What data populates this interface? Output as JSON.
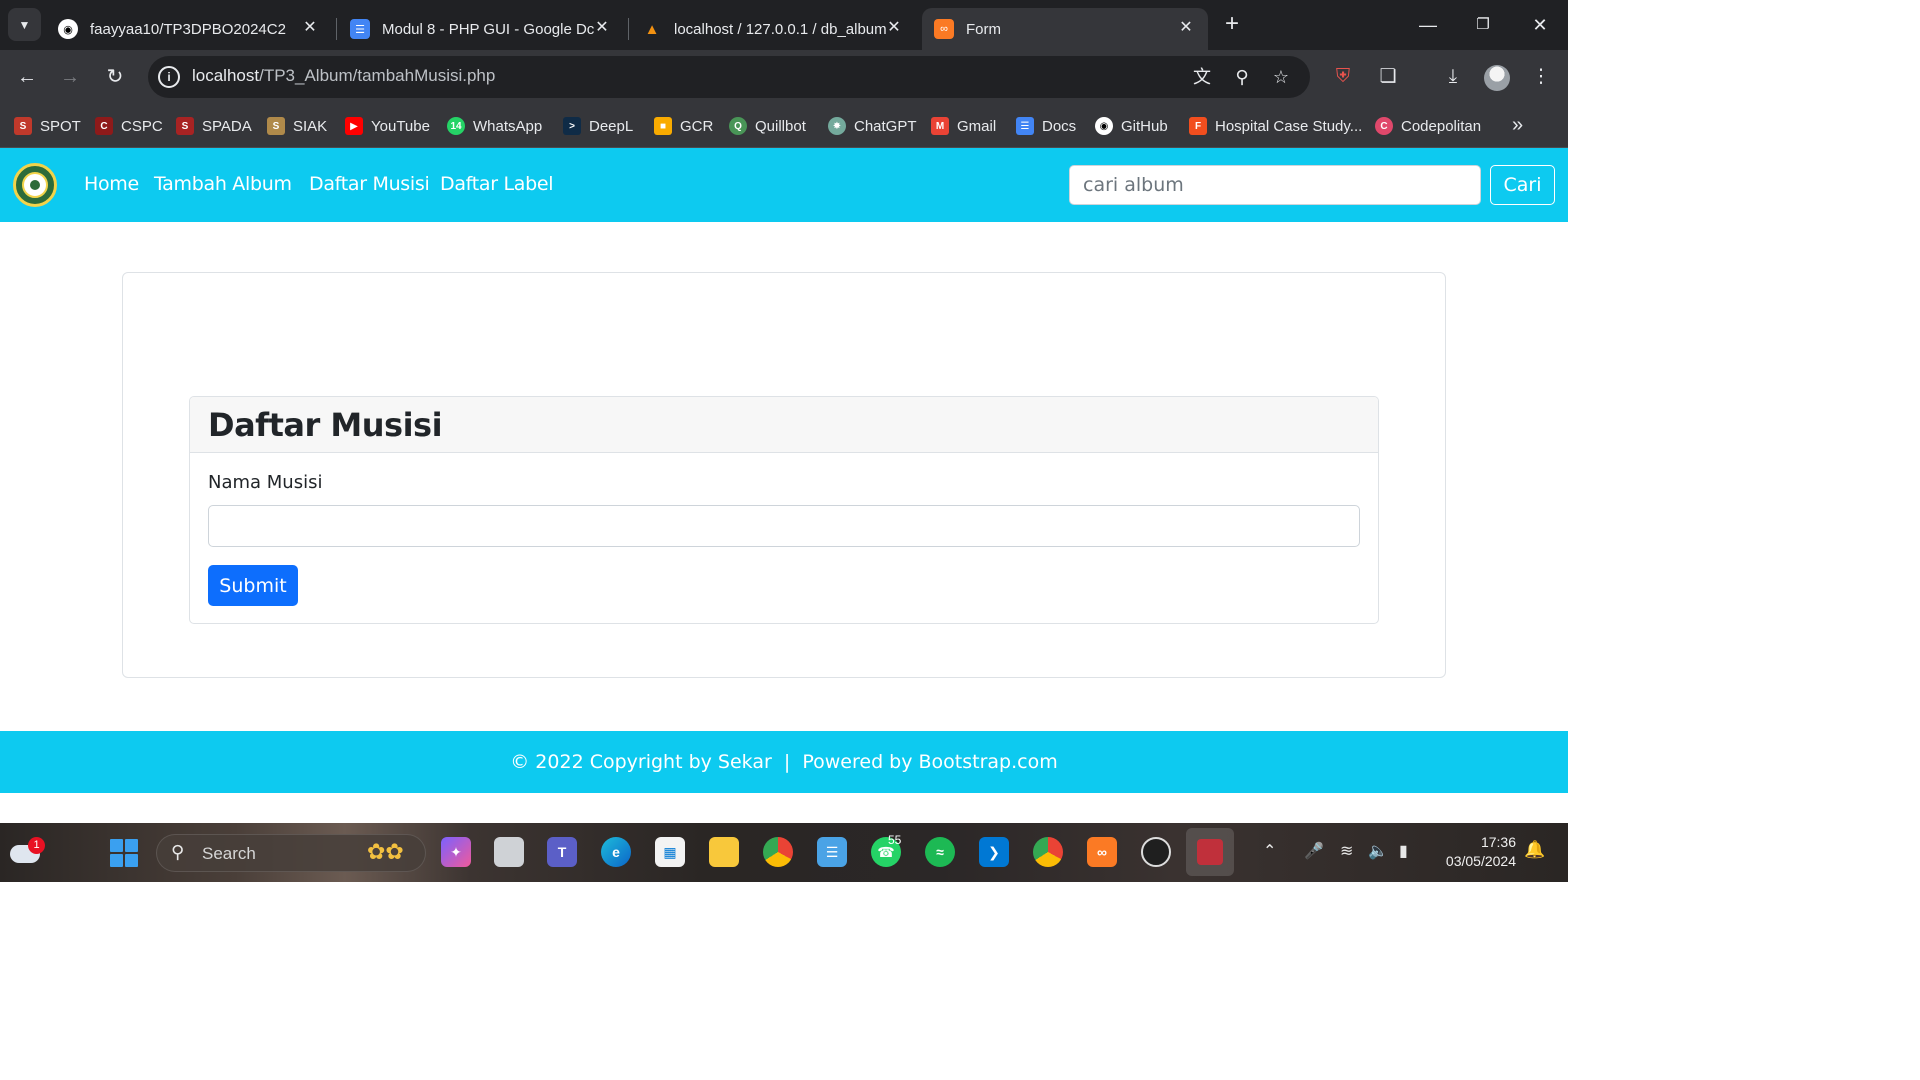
{
  "browser": {
    "tabs": [
      {
        "title": "faayyaa10/TP3DPBO2024C2",
        "icon": "github-icon",
        "active": false
      },
      {
        "title": "Modul 8 - PHP GUI - Google Dc",
        "icon": "google-docs-icon",
        "active": false
      },
      {
        "title": "localhost / 127.0.0.1 / db_album",
        "icon": "phpmyadmin-icon",
        "active": false
      },
      {
        "title": "Form",
        "icon": "xampp-icon",
        "active": true
      }
    ],
    "url_host": "localhost",
    "url_path": "/TP3_Album/tambahMusisi.php",
    "bookmarks": [
      "SPOT",
      "CSPC",
      "SPADA",
      "SIAK",
      "YouTube",
      "WhatsApp",
      "DeepL",
      "GCR",
      "Quillbot",
      "ChatGPT",
      "Gmail",
      "Docs",
      "GitHub",
      "Hospital Case Study...",
      "Codepolitan"
    ]
  },
  "navbar": {
    "links": [
      "Home",
      "Tambah Album",
      "Daftar Musisi",
      "Daftar Label"
    ],
    "search_placeholder": "cari album",
    "search_button": "Cari",
    "bg_color": "#0dcaf0"
  },
  "form": {
    "title": "Daftar Musisi",
    "label": "Nama Musisi",
    "input_value": "",
    "submit_label": "Submit",
    "button_color": "#0d6efd"
  },
  "footer": {
    "text": "© 2022 Copyright by Sekar  |  Powered by Bootstrap.com"
  },
  "taskbar": {
    "search_text": "Search",
    "weather_badge": "1",
    "whatsapp_count": "55",
    "time": "17:36",
    "date": "03/05/2024"
  }
}
